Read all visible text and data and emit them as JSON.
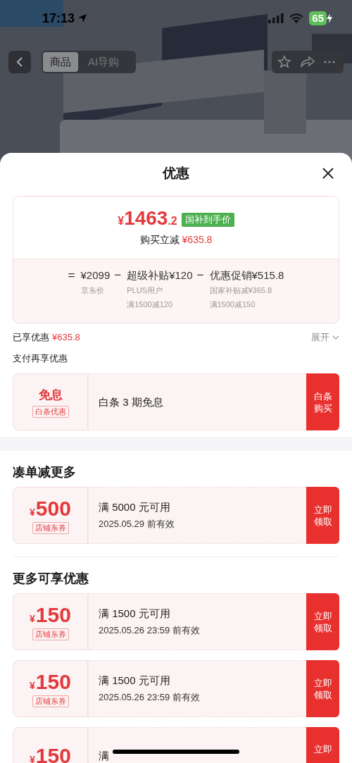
{
  "status_bar": {
    "time": "17:13",
    "battery": "65"
  },
  "nav": {
    "tabs": [
      {
        "label": "商品",
        "selected": true
      },
      {
        "label": "AI导购",
        "selected": false
      }
    ]
  },
  "sheet": {
    "title": "优惠",
    "price": {
      "currency": "¥",
      "integer": "1463",
      "decimal": ".2",
      "badge": "国补到手价",
      "saving_label": "购买立减",
      "saving_amount": "¥635.8"
    },
    "breakdown": [
      {
        "operator": "=",
        "main": "¥2099",
        "notes": [
          "京东价"
        ]
      },
      {
        "operator": "−",
        "main": "超级补贴¥120",
        "notes": [
          "PLUS用户",
          "满1500减120"
        ]
      },
      {
        "operator": "−",
        "main": "优惠促销¥515.8",
        "notes": [
          "国家补贴减¥365.8",
          "满1500减150"
        ]
      }
    ],
    "enjoyed": {
      "label": "已享优惠",
      "amount": "¥635.8",
      "expand": "展开"
    },
    "pay_heading": "支付再享优惠",
    "sections": [
      {
        "coupons": [
          {
            "kind": "benefit",
            "value": "免息",
            "tag": "白条优惠",
            "title": "白条 3 期免息",
            "button": [
              "白条",
              "购买"
            ]
          }
        ]
      },
      {
        "heading": "凑单减更多",
        "coupons": [
          {
            "kind": "amount",
            "currency": "¥",
            "value": "500",
            "tag": "店铺东券",
            "title": "满 5000 元可用",
            "validity": "2025.05.29 前有效",
            "button": [
              "立即",
              "领取"
            ]
          }
        ]
      },
      {
        "heading": "更多可享优惠",
        "coupons": [
          {
            "kind": "amount",
            "currency": "¥",
            "value": "150",
            "tag": "店铺东券",
            "title": "满 1500 元可用",
            "validity": "2025.05.26 23:59 前有效",
            "button": [
              "立即",
              "领取"
            ]
          },
          {
            "kind": "amount",
            "currency": "¥",
            "value": "150",
            "tag": "店铺东券",
            "title": "满 1500 元可用",
            "validity": "2025.05.26 23:59 前有效",
            "button": [
              "立即",
              "领取"
            ]
          },
          {
            "kind": "amount",
            "currency": "¥",
            "value": "150",
            "title": "满",
            "button": [
              "立即"
            ]
          }
        ]
      }
    ]
  }
}
